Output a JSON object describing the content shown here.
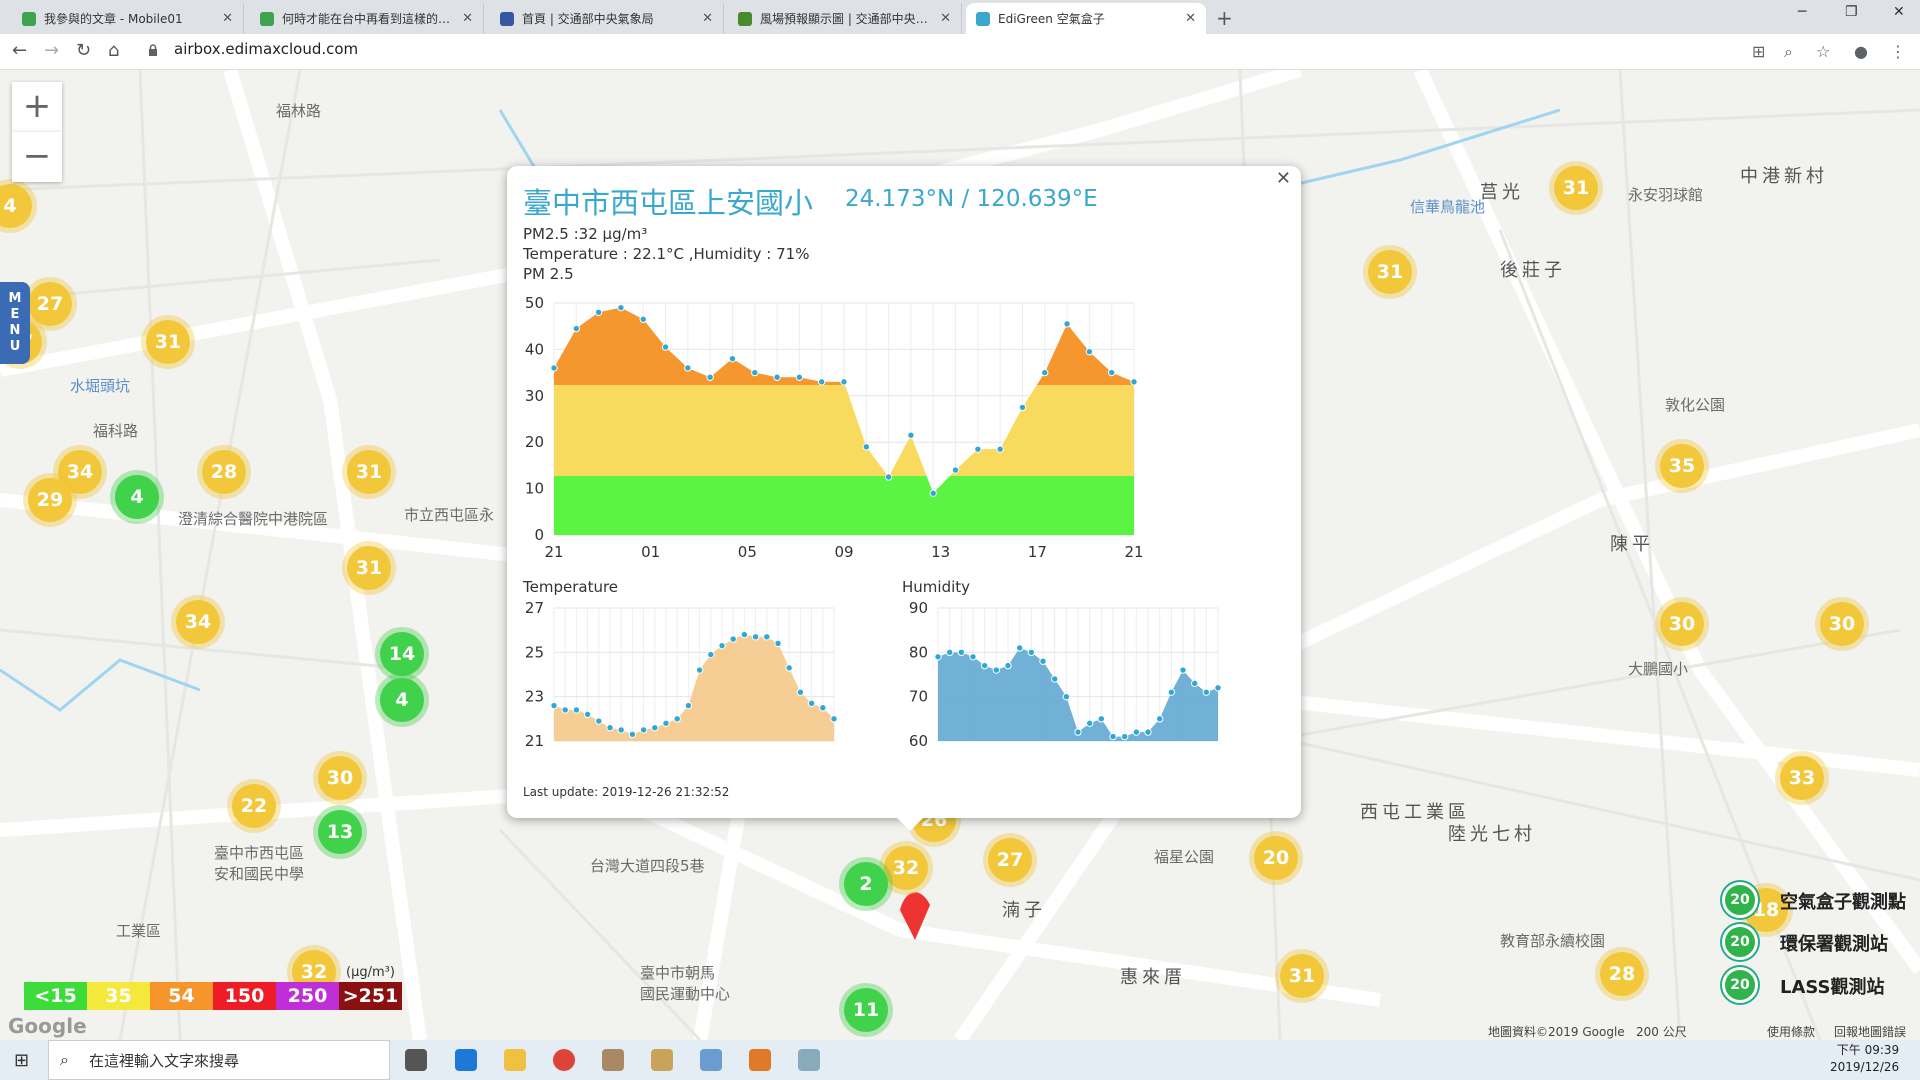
{
  "browser": {
    "tabs": [
      {
        "title": "我參與的文章 - Mobile01",
        "color": "#3fa34d",
        "active": false
      },
      {
        "title": "何時才能在台中再看到這樣的藍天",
        "color": "#3fa34d",
        "active": false
      },
      {
        "title": "首頁 | 交通部中央氣象局",
        "color": "#3558a0",
        "active": false
      },
      {
        "title": "風場預報顯示圖 | 交通部中央氣象局",
        "color": "#4a8a2f",
        "active": false
      },
      {
        "title": "EdiGreen 空氣盒子",
        "color": "#3aa7cd",
        "active": true
      }
    ],
    "url": "airbox.edimaxcloud.com"
  },
  "map": {
    "menu_label": "MENU",
    "clusters": [
      {
        "v": "4",
        "c": "y"
      },
      {
        "v": "27",
        "c": "y"
      },
      {
        "v": "27",
        "c": "y"
      },
      {
        "v": "31",
        "c": "y"
      },
      {
        "v": "34",
        "c": "y"
      },
      {
        "v": "29",
        "c": "y"
      },
      {
        "v": "4",
        "c": "g"
      },
      {
        "v": "28",
        "c": "y"
      },
      {
        "v": "31",
        "c": "y"
      },
      {
        "v": "31",
        "c": "y"
      },
      {
        "v": "34",
        "c": "y"
      },
      {
        "v": "14",
        "c": "g"
      },
      {
        "v": "4",
        "c": "g"
      },
      {
        "v": "30",
        "c": "y"
      },
      {
        "v": "22",
        "c": "y"
      },
      {
        "v": "13",
        "c": "g"
      },
      {
        "v": "32",
        "c": "y"
      },
      {
        "v": "26",
        "c": "y"
      },
      {
        "v": "32",
        "c": "y"
      },
      {
        "v": "2",
        "c": "g"
      },
      {
        "v": "27",
        "c": "y"
      },
      {
        "v": "11",
        "c": "g"
      },
      {
        "v": "20",
        "c": "y"
      },
      {
        "v": "31",
        "c": "y"
      },
      {
        "v": "31",
        "c": "y"
      },
      {
        "v": "31",
        "c": "y"
      },
      {
        "v": "35",
        "c": "y"
      },
      {
        "v": "30",
        "c": "y"
      },
      {
        "v": "30",
        "c": "y"
      },
      {
        "v": "33",
        "c": "y"
      },
      {
        "v": "28",
        "c": "y"
      },
      {
        "v": "18",
        "c": "y"
      }
    ],
    "labels": [
      {
        "t": "福科路",
        "cls": ""
      },
      {
        "t": "水堀頭坑",
        "cls": "blue"
      },
      {
        "t": "市立西屯區永",
        "cls": ""
      },
      {
        "t": "澄清綜合醫院中港院區",
        "cls": ""
      },
      {
        "t": "臺中市西屯區\n安和國民中學",
        "cls": ""
      },
      {
        "t": "台灣大道四段5巷",
        "cls": ""
      },
      {
        "t": "臺中市朝馬\n國民運動中心",
        "cls": ""
      },
      {
        "t": "福星公園",
        "cls": ""
      },
      {
        "t": "惠來厝",
        "cls": "big"
      },
      {
        "t": "湳子",
        "cls": "big"
      },
      {
        "t": "西屯工業區",
        "cls": "big"
      },
      {
        "t": "陸光七村",
        "cls": "big"
      },
      {
        "t": "後莊子",
        "cls": "big"
      },
      {
        "t": "莒光",
        "cls": "big"
      },
      {
        "t": "中港新村",
        "cls": "big"
      },
      {
        "t": "陳平",
        "cls": "big"
      },
      {
        "t": "敦化公園",
        "cls": ""
      },
      {
        "t": "永安羽球館",
        "cls": ""
      },
      {
        "t": "信華鳥龍池",
        "cls": "blue"
      },
      {
        "t": "大鵬國小",
        "cls": ""
      },
      {
        "t": "教育部永續校園",
        "cls": ""
      },
      {
        "t": "福林路",
        "cls": ""
      },
      {
        "t": "工業區",
        "cls": ""
      }
    ],
    "legend": [
      {
        "t": "<15",
        "bg": "#3ddc3a"
      },
      {
        "t": "35",
        "bg": "#f5e83c"
      },
      {
        "t": "54",
        "bg": "#f5952c"
      },
      {
        "t": "150",
        "bg": "#ee1c24"
      },
      {
        "t": "250",
        "bg": "#bf2fd8"
      },
      {
        "t": ">251",
        "bg": "#8b1010"
      }
    ],
    "legend_unit": "(μg/m³)",
    "station_legend": [
      {
        "label": "空氣盒子觀測點",
        "badge": "20"
      },
      {
        "label": "環保署觀測站",
        "badge": "20"
      },
      {
        "label": "LASS觀測站",
        "badge": "20"
      }
    ],
    "attribution": {
      "data": "地圖資料©2019 Google",
      "scale": "200 公尺",
      "terms": "使用條款",
      "report": "回報地圖錯誤"
    }
  },
  "popup": {
    "title": "臺中市西屯區上安國小",
    "coords": "24.173°N / 120.639°E",
    "pm_line": "PM2.5 :32 μg/m³",
    "th_line": "Temperature : 22.1°C ,Humidity : 71%",
    "pm_chart_title": "PM 2.5",
    "temp_title": "Temperature",
    "hum_title": "Humidity",
    "last_update": "Last update: 2019-12-26 21:32:52"
  },
  "chart_data": [
    {
      "type": "area",
      "title": "PM 2.5",
      "x_tick_labels": [
        "21",
        "01",
        "05",
        "09",
        "13",
        "17",
        "21"
      ],
      "ylim": [
        0,
        50
      ],
      "y_ticks": [
        0,
        10,
        20,
        30,
        40,
        50
      ],
      "values": [
        36,
        44.5,
        48,
        49,
        46.5,
        40.5,
        36,
        34,
        38,
        35,
        34,
        34,
        33,
        33,
        19,
        12.5,
        21.5,
        9,
        14,
        18.5,
        18.5,
        27.5,
        35,
        45.5,
        39.5,
        35,
        33
      ],
      "bands": [
        {
          "from": 0,
          "to": 13,
          "color": "#5cf442"
        },
        {
          "from": 13,
          "to": 33,
          "color": "#f7da5e"
        },
        {
          "from": 33,
          "to": 50,
          "color": "#f5962e"
        }
      ]
    },
    {
      "type": "area",
      "title": "Temperature",
      "ylim": [
        21,
        27
      ],
      "y_ticks": [
        21,
        23,
        25,
        27
      ],
      "values": [
        22.6,
        22.4,
        22.4,
        22.2,
        21.9,
        21.6,
        21.5,
        21.3,
        21.5,
        21.6,
        21.8,
        22.0,
        22.6,
        24.2,
        24.9,
        25.3,
        25.6,
        25.8,
        25.7,
        25.7,
        25.4,
        24.3,
        23.2,
        22.7,
        22.5,
        22.0
      ],
      "color": "#f5c98a"
    },
    {
      "type": "area",
      "title": "Humidity",
      "ylim": [
        60,
        90
      ],
      "y_ticks": [
        60,
        70,
        80,
        90
      ],
      "values": [
        79,
        80,
        80,
        79,
        77,
        76,
        77,
        81,
        80,
        78,
        74,
        70,
        62,
        64,
        65,
        61,
        61,
        62,
        62,
        65,
        71,
        76,
        73,
        71,
        72
      ],
      "color": "#62a9d3"
    }
  ]
}
